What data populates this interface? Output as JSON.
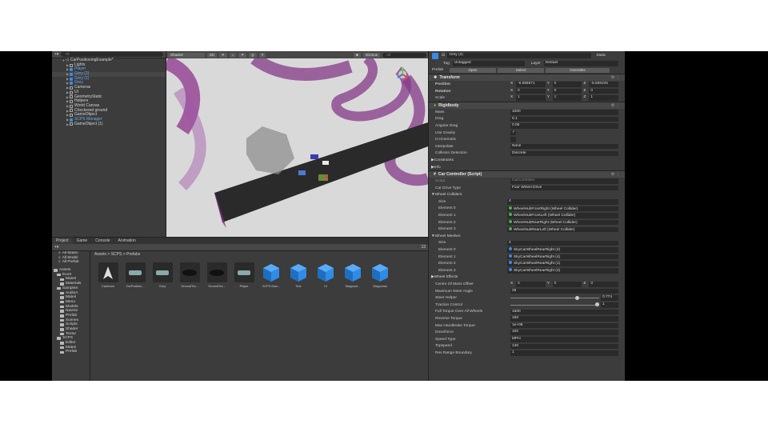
{
  "hierarchy": {
    "search_placeholder": "All",
    "scene": "CarPositioningExample*",
    "items": [
      {
        "label": "Lights",
        "blue": false,
        "sel": false
      },
      {
        "label": "Player",
        "blue": true,
        "sel": false
      },
      {
        "label": "Grey (2)",
        "blue": true,
        "sel": true
      },
      {
        "label": "Grey (1)",
        "blue": true,
        "sel": false
      },
      {
        "label": "Grey",
        "blue": true,
        "sel": false
      },
      {
        "label": "Cameras",
        "blue": false,
        "sel": false
      },
      {
        "label": "UI",
        "blue": false,
        "sel": false
      },
      {
        "label": "GeometryStatic",
        "blue": false,
        "sel": false
      },
      {
        "label": "Helpers",
        "blue": false,
        "sel": false
      },
      {
        "label": "World Canvas",
        "blue": false,
        "sel": false
      },
      {
        "label": "Checkered ground",
        "blue": false,
        "sel": false
      },
      {
        "label": "GameObject",
        "blue": false,
        "sel": false
      },
      {
        "label": "SCPS Manager",
        "blue": true,
        "sel": false
      },
      {
        "label": "GameObject (1)",
        "blue": false,
        "sel": false
      }
    ]
  },
  "scene": {
    "shading": "Shaded",
    "mode_2d": "2D",
    "gizmos": "Gizmos",
    "search_placeholder": "All"
  },
  "project": {
    "tabs": [
      "Project",
      "Game",
      "Console",
      "Animation"
    ],
    "breadcrumb": "Assets > SCPS > Prefabs",
    "count": "13",
    "favorites": [
      "All Materi",
      "All Model",
      "All Prefab"
    ],
    "folders": [
      "Assets",
      "EvoX",
      "Materi",
      "Materials",
      "SampleS",
      "AudioA",
      "Materi",
      "Menu",
      "Models",
      "Navme",
      "Prefab",
      "Scenes",
      "Scripts",
      "Shader",
      "Textur",
      "SCPS",
      "Editor",
      "Materi",
      "Prefab"
    ],
    "assets": [
      "CarArrow",
      "CarPosition...",
      "Grey",
      "GroundTra...",
      "GroundTra...",
      "Player",
      "SCPS Man...",
      "Text",
      "UI",
      "Waypoint...",
      "Waypoints"
    ]
  },
  "inspector": {
    "name": "Grey (2)",
    "static": "Static",
    "tag_label": "Tag",
    "tag": "Untagged",
    "layer_label": "Layer",
    "layer": "Default",
    "prefab_label": "Prefab",
    "open": "Open",
    "select": "Select",
    "overrides": "Overrides",
    "transform": {
      "title": "Transform",
      "position_label": "Position",
      "position": [
        "-6.598671",
        "0",
        "-6.569225"
      ],
      "rotation_label": "Rotation",
      "rotation": [
        "0",
        "0",
        "0"
      ],
      "scale_label": "Scale",
      "scale": [
        "1",
        "1",
        "1"
      ]
    },
    "rigidbody": {
      "title": "Rigidbody",
      "rows": [
        {
          "label": "Mass",
          "value": "1000"
        },
        {
          "label": "Drag",
          "value": "0.1"
        },
        {
          "label": "Angular Drag",
          "value": "0.05"
        },
        {
          "label": "Use Gravity",
          "value": "✓"
        },
        {
          "label": "Is Kinematic",
          "value": ""
        },
        {
          "label": "Interpolate",
          "value": "None"
        },
        {
          "label": "Collision Detection",
          "value": "Discrete"
        }
      ],
      "constraints": "Constraints",
      "info": "Info"
    },
    "car_controller": {
      "title": "Car Controller (Script)",
      "script_label": "Script",
      "script": "CarController",
      "drive_label": "Car Drive Type",
      "drive": "Four Wheel Drive",
      "wheel_colliders": "Wheel Colliders",
      "size_label": "Size",
      "colliders_size": "4",
      "colliders": [
        {
          "label": "Element 0",
          "value": "WheelHubFrontRight (Wheel Collider)"
        },
        {
          "label": "Element 1",
          "value": "WheelHubFrontLeft (Wheel Collider)"
        },
        {
          "label": "Element 2",
          "value": "WheelHubRearRight (Wheel Collider)"
        },
        {
          "label": "Element 3",
          "value": "WheelHubRearLeft (Wheel Collider)"
        }
      ],
      "wheel_meshes": "Wheel Meshes",
      "meshes_size": "4",
      "meshes": [
        {
          "label": "Element 0",
          "value": "SkyCarWheelRearRight (2)"
        },
        {
          "label": "Element 1",
          "value": "SkyCarWheelRearRight (4)"
        },
        {
          "label": "Element 2",
          "value": "SkyCarWheelRearRight (1)"
        },
        {
          "label": "Element 3",
          "value": "SkyCarWheelRearRight (3)"
        }
      ],
      "wheel_effects": "Wheel Effects",
      "com_label": "Centre Of Mass Offset",
      "com": [
        "0",
        "0",
        "0"
      ],
      "rows": [
        {
          "label": "Maximum Steer Angle",
          "value": "25"
        },
        {
          "label": "Steer Helper",
          "value": "0.774"
        },
        {
          "label": "Traction Control",
          "value": "1"
        },
        {
          "label": "Full Torque Over All Wheels",
          "value": "1500"
        },
        {
          "label": "Reverse Torque",
          "value": "150"
        },
        {
          "label": "Max Handbrake Torque",
          "value": "1e+08"
        },
        {
          "label": "Downforce",
          "value": "100"
        },
        {
          "label": "Speed Type",
          "value": "MPH"
        },
        {
          "label": "Topspeed",
          "value": "140"
        },
        {
          "label": "Rev Range Boundary",
          "value": "1"
        }
      ],
      "steer_helper_fraction": 0.774,
      "traction_fraction": 1.0
    }
  }
}
